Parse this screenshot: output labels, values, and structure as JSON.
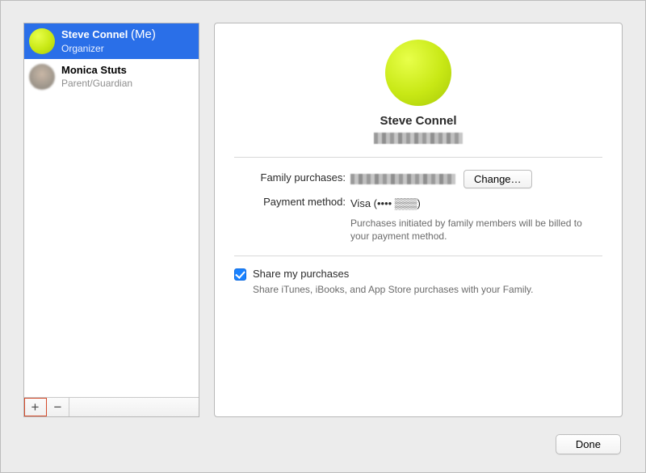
{
  "sidebar": {
    "members": [
      {
        "name": "Steve Connel",
        "me_suffix": "(Me)",
        "role": "Organizer",
        "selected": true,
        "avatar": "tennis-ball"
      },
      {
        "name": "Monica Stuts",
        "me_suffix": "",
        "role": "Parent/Guardian",
        "selected": false,
        "avatar": "blur"
      }
    ],
    "add_label": "+",
    "remove_label": "−"
  },
  "detail": {
    "profile_name": "Steve Connel",
    "family_purchases_label": "Family purchases:",
    "change_button": "Change…",
    "payment_method_label": "Payment method:",
    "payment_method_value": "Visa (•••• ▒▒▒)",
    "payment_note": "Purchases initiated by family members will be billed to your payment method.",
    "share_checkbox_label": "Share my purchases",
    "share_checkbox_desc": "Share iTunes, iBooks, and App Store purchases with your Family.",
    "share_checked": true
  },
  "footer": {
    "done_label": "Done"
  }
}
